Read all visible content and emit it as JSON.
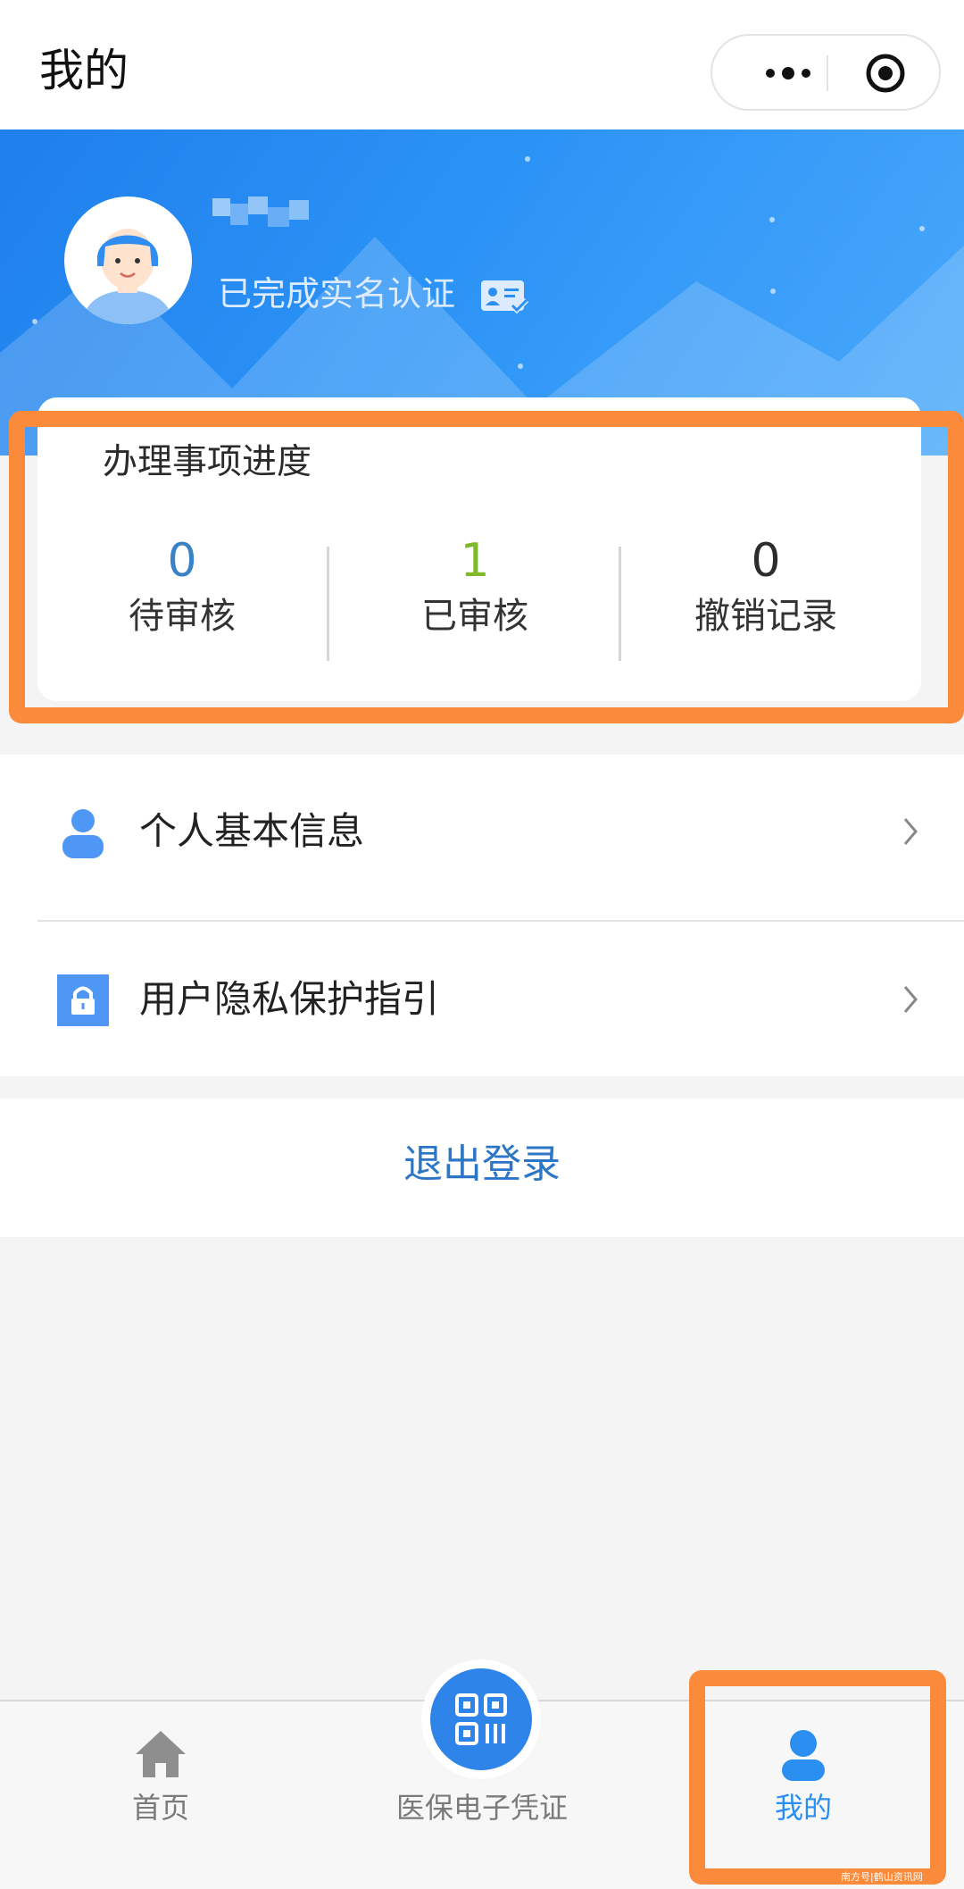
{
  "header": {
    "title": "我的"
  },
  "profile": {
    "verified_text": "已完成实名认证"
  },
  "progress": {
    "title": "办理事项进度",
    "stats": [
      {
        "value": "0",
        "label": "待审核",
        "color": "#3a82c8"
      },
      {
        "value": "1",
        "label": "已审核",
        "color": "#7fb82a"
      },
      {
        "value": "0",
        "label": "撤销记录",
        "color": "#2c2c2c"
      }
    ]
  },
  "menu": {
    "items": [
      {
        "label": "个人基本信息"
      },
      {
        "label": "用户隐私保护指引"
      }
    ]
  },
  "logout": {
    "label": "退出登录"
  },
  "tabbar": {
    "tabs": [
      {
        "label": "首页"
      },
      {
        "label": "医保电子凭证"
      },
      {
        "label": "我的"
      }
    ]
  },
  "watermark": "南方号|鹤山资讯网",
  "colors": {
    "accent": "#2b8ff2",
    "highlight": "#fb8a3a",
    "link": "#2b76c6"
  }
}
